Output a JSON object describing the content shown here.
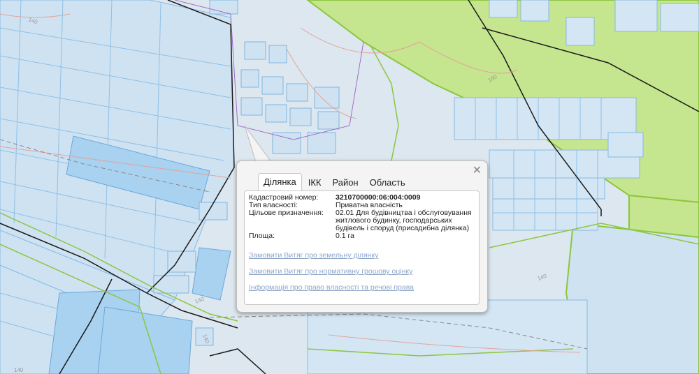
{
  "popup": {
    "close_icon": "close-icon",
    "tabs": [
      {
        "label": "Ділянка",
        "active": true
      },
      {
        "label": "ІКК",
        "active": false
      },
      {
        "label": "Район",
        "active": false
      },
      {
        "label": "Область",
        "active": false
      }
    ],
    "fields": [
      {
        "label": "Кадастровий номер:",
        "value": "3210700000:06:004:0009"
      },
      {
        "label": "Тип власності:",
        "value": "Приватна власність"
      },
      {
        "label": "Цільове призначення:",
        "value": "02.01 Для будівництва і обслуговування житлового будинку, господарських будівель і споруд (присадибна ділянка)"
      },
      {
        "label": "Площа:",
        "value": "0.1 га"
      }
    ],
    "links": [
      "Замовити Витяг про земельну ділянку",
      "Замовити Витяг про нормативну грошову оцінку",
      "Інформація про право власності та речові права"
    ]
  },
  "map": {
    "contour_labels": [
      "140",
      "140",
      "140",
      "140",
      "150",
      "140"
    ],
    "colors": {
      "background": "#dde7ef",
      "parcel_fill": "#cfe3f3",
      "parcel_stroke": "#7fb6e0",
      "forest": "#c6e68f",
      "forest_stroke": "#8cc63f",
      "road": "#1a1a1a",
      "blue_parcel": "#8fc3ea"
    }
  }
}
